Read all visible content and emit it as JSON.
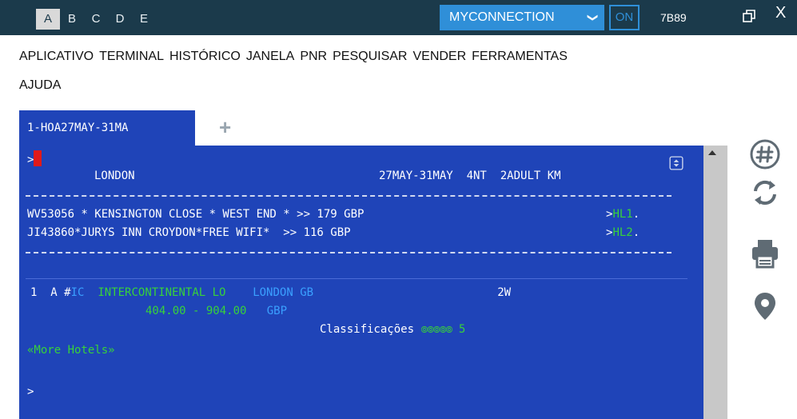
{
  "session_tabs": [
    "A",
    "B",
    "C",
    "D",
    "E"
  ],
  "active_session": "A",
  "connection": {
    "label": "MYCONNECTION",
    "status": "ON",
    "office_id": "7B89"
  },
  "window": {
    "close_label": "X"
  },
  "menu": [
    "APLICATIVO",
    "TERMINAL",
    "HISTÓRICO",
    "JANELA",
    "PNR",
    "PESQUISAR",
    "VENDER",
    "FERRAMENTAS",
    "AJUDA"
  ],
  "terminal_tab": {
    "label": "1-HOA27MAY-31MA",
    "add_label": "+"
  },
  "terminal": {
    "prompt": ">",
    "header": {
      "city": "LONDON",
      "dates": "27MAY-31MAY",
      "nights": "4NT",
      "guests": "2ADULT",
      "unit": "KM"
    },
    "results": [
      {
        "text": "WV53056 * KENSINGTON CLOSE * WEST END * >> 179 GBP",
        "ref_prefix": ">",
        "ref": "HL1",
        "dot": "."
      },
      {
        "text": "JI43860*JURYS INN CROYDON*FREE WIFI*  >> 116 GBP",
        "ref_prefix": ">",
        "ref": "HL2",
        "dot": "."
      }
    ],
    "hotel": {
      "index": "1",
      "type": "A",
      "hash": "#",
      "chain": "IC",
      "name": "INTERCONTINENTAL LO",
      "location": "LONDON GB",
      "distance": "2W",
      "rate": "404.00 - 904.00",
      "currency": "GBP",
      "rating_label": "Classificações",
      "rating_dots": "⦾⦾⦾⦾⦾",
      "rating_value": "5"
    },
    "more_hotels": "«More Hotels»",
    "bottom_prompt": ">"
  },
  "colors": {
    "terminal_bg": "#1f44b8",
    "accent": "#2f8fd8",
    "topbar": "#1b3a4b",
    "highlight_green": "#37d23a",
    "link_blue": "#3aa0ff"
  },
  "side_icons": [
    "hash-icon",
    "refresh-icon",
    "print-icon",
    "location-pin-icon"
  ]
}
